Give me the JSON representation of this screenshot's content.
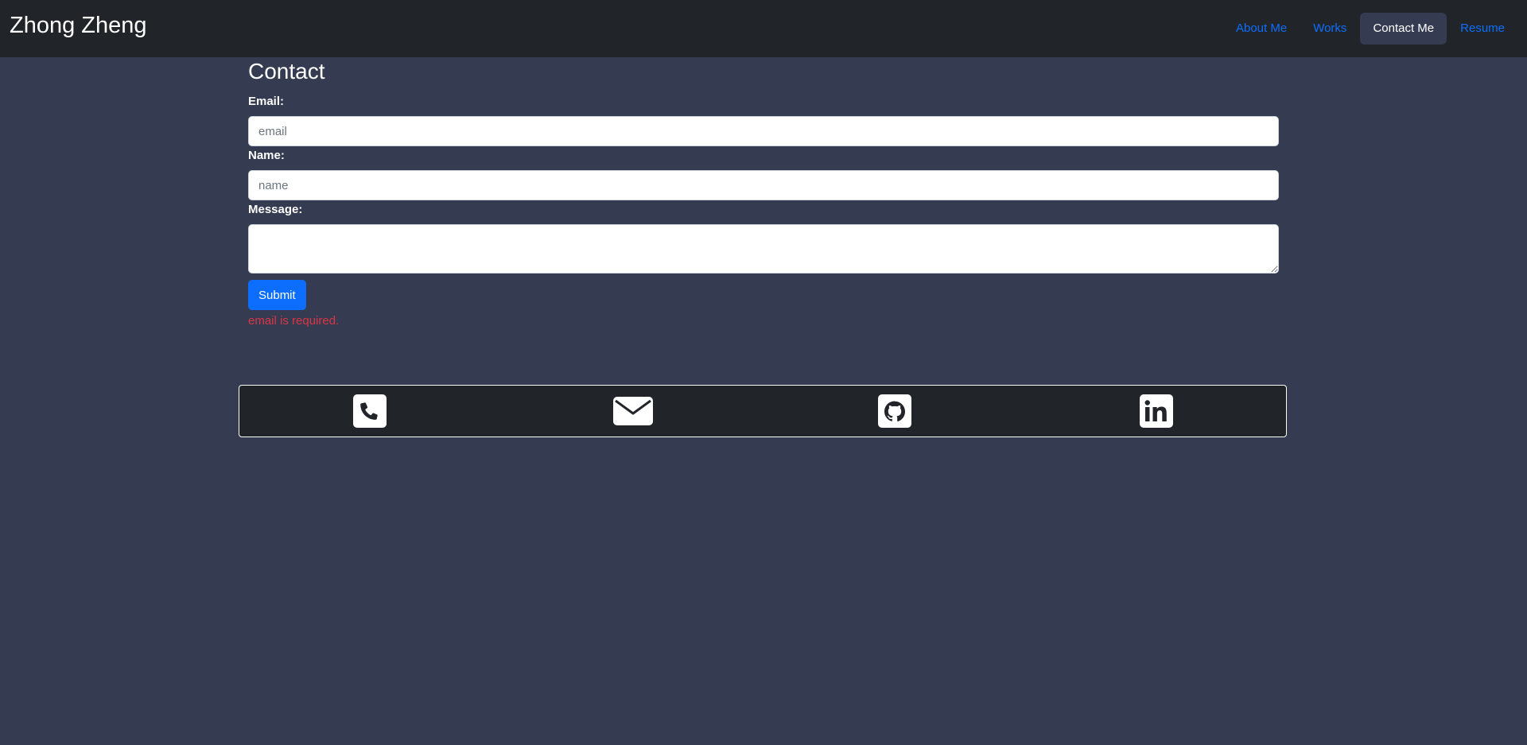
{
  "header": {
    "brand": "Zhong Zheng",
    "nav": [
      {
        "label": "About Me",
        "active": false
      },
      {
        "label": "Works",
        "active": false
      },
      {
        "label": "Contact Me",
        "active": true
      },
      {
        "label": "Resume",
        "active": false
      }
    ]
  },
  "contact": {
    "title": "Contact",
    "email_label": "Email:",
    "email_placeholder": "email",
    "email_value": "",
    "name_label": "Name:",
    "name_placeholder": "name",
    "name_value": "",
    "message_label": "Message:",
    "message_value": "",
    "submit_label": "Submit",
    "error": "email is required."
  },
  "social": [
    {
      "icon": "phone-icon"
    },
    {
      "icon": "envelope-icon"
    },
    {
      "icon": "github-icon"
    },
    {
      "icon": "linkedin-icon"
    }
  ],
  "colors": {
    "page_bg": "#353c51",
    "navbar_bg": "#212529",
    "link": "#0d6efd",
    "button": "#0d6efd",
    "error": "#dc3545"
  }
}
